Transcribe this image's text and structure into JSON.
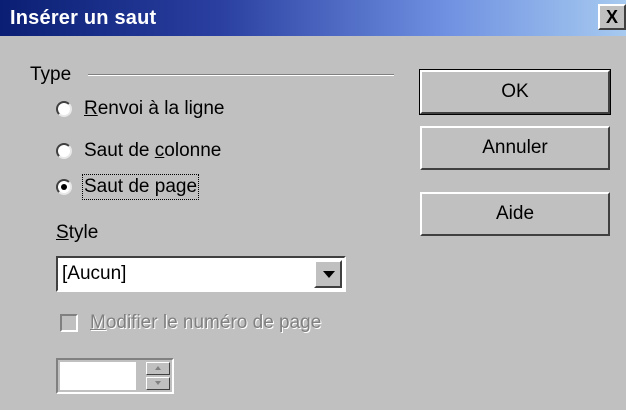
{
  "window": {
    "title": "Insérer un saut",
    "close_label": "X"
  },
  "type_group": {
    "label": "Type",
    "options": [
      {
        "prefix": "",
        "mnemonic": "R",
        "suffix": "envoi à la ligne",
        "checked": false
      },
      {
        "prefix": "Saut de ",
        "mnemonic": "c",
        "suffix": "olonne",
        "checked": false
      },
      {
        "prefix": "Saut de pa",
        "mnemonic": "g",
        "suffix": "e",
        "checked": true
      }
    ]
  },
  "style": {
    "label_mnemonic": "S",
    "label_rest": "tyle",
    "value": "[Aucun]"
  },
  "modify_page_number": {
    "mnemonic": "M",
    "label_rest": "odifier le numéro de page",
    "checked": false,
    "enabled": false
  },
  "page_number": {
    "value": ""
  },
  "buttons": {
    "ok": "OK",
    "cancel": "Annuler",
    "help": "Aide"
  }
}
